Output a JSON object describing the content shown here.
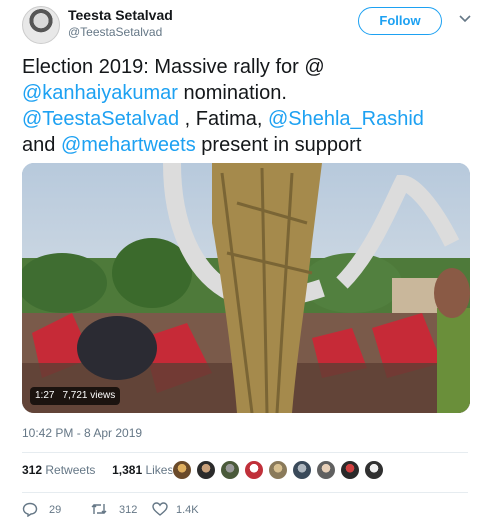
{
  "author": {
    "name": "Teesta Setalvad",
    "handle": "@TeestaSetalvad",
    "follow_label": "Follow"
  },
  "tweet": {
    "parts": [
      {
        "text": "Election 2019: Massive rally for @",
        "type": "text"
      },
      {
        "text": "@kanhaiyakumar",
        "type": "mention"
      },
      {
        "text": " nomination. ",
        "type": "text"
      },
      {
        "text": "@TeestaSetalvad",
        "type": "mention"
      },
      {
        "text": " , Fatima, ",
        "type": "text"
      },
      {
        "text": "@Shehla_Rashid",
        "type": "mention"
      },
      {
        "text": " and ",
        "type": "text"
      },
      {
        "text": "@mehartweets",
        "type": "mention"
      },
      {
        "text": " present in support",
        "type": "text"
      }
    ]
  },
  "video": {
    "duration": "1:27",
    "views": "7,721 views"
  },
  "timestamp": "10:42 PM - 8 Apr 2019",
  "stats": {
    "retweets_count": "312",
    "retweets_label": "Retweets",
    "likes_count": "1,381",
    "likes_label": "Likes"
  },
  "actions": {
    "replies": "29",
    "retweets": "312",
    "likes": "1.4K"
  },
  "colors": {
    "link": "#1da1f2",
    "secondary_text": "#657786",
    "divider": "#e6ecf0"
  }
}
